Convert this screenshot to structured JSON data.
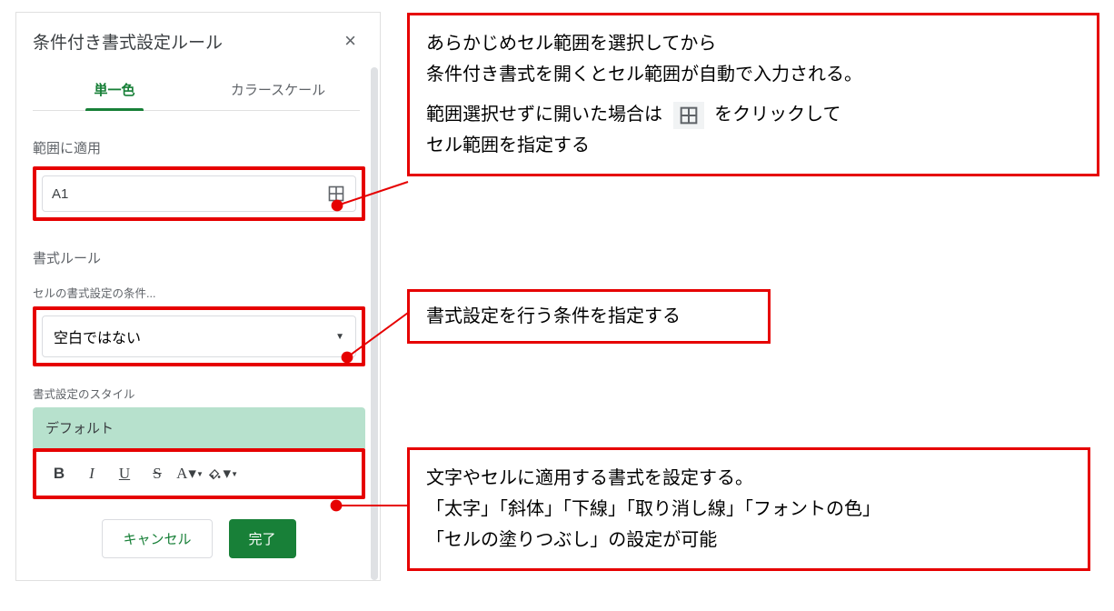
{
  "panel": {
    "title": "条件付き書式設定ルール",
    "tabs": {
      "single": "単一色",
      "scale": "カラースケール"
    },
    "range": {
      "label": "範囲に適用",
      "value": "A1"
    },
    "rules": {
      "label": "書式ルール",
      "condition_sublabel": "セルの書式設定の条件...",
      "condition_value": "空白ではない"
    },
    "style": {
      "label": "書式設定のスタイル",
      "preview": "デフォルト"
    },
    "toolbar": {
      "bold": "B",
      "italic": "I",
      "underline": "U",
      "strike": "S",
      "textcolor": "A",
      "fill": "fill"
    },
    "footer": {
      "cancel": "キャンセル",
      "done": "完了"
    }
  },
  "annotations": {
    "a1_l1": "あらかじめセル範囲を選択してから",
    "a1_l2": "条件付き書式を開くとセル範囲が自動で入力される。",
    "a1_l3a": "範囲選択せずに開いた場合は",
    "a1_l3b": "をクリックして",
    "a1_l4": "セル範囲を指定する",
    "a2": "書式設定を行う条件を指定する",
    "a3_l1": "文字やセルに適用する書式を設定する。",
    "a3_l2": "「太字」「斜体」「下線」「取り消し線」「フォントの色」",
    "a3_l3": "「セルの塗りつぶし」の設定が可能"
  }
}
